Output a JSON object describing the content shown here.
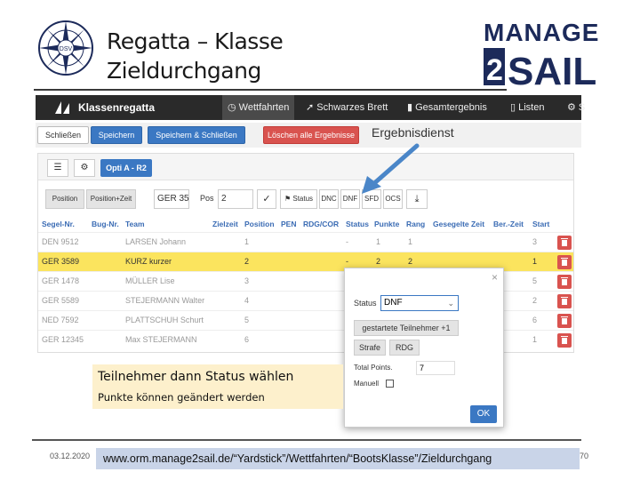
{
  "slide": {
    "title_line1": "Regatta – Klasse",
    "title_line2": "Zieldurchgang",
    "logo_right_line1": "MANAGE",
    "logo_right_num": "2",
    "logo_right_line2": "SAIL",
    "logo_left_text": "DSV"
  },
  "navbar": {
    "brand": "Klassenregatta",
    "items": [
      "Wettfahrten",
      "Schwarzes Brett",
      "Gesamtergebnis",
      "Listen",
      "S"
    ],
    "active_index": 0
  },
  "toolbar": {
    "buttons": [
      "Schließen",
      "Speichern",
      "Speichern & Schließen",
      "Löschen alle Ergebnisse"
    ],
    "heading": "Ergebnisdienst"
  },
  "race": {
    "label": "Opti A - R2"
  },
  "controls": {
    "position_tab": "Position",
    "position_time_tab": "Position+Zeit",
    "sail_no_value": "GER 35",
    "pos_label": "Pos",
    "pos_value": "2",
    "status_btn": "Status",
    "quick": [
      "DNC",
      "DNF",
      "SFD",
      "OCS"
    ]
  },
  "table": {
    "headers": [
      "Segel-Nr.",
      "Bug-Nr.",
      "Team",
      "Zielzeit",
      "Position",
      "PEN",
      "RDG/COR",
      "Status",
      "Punkte",
      "Rang",
      "Gesegelte Zeit",
      "Ber.-Zeit",
      "Start"
    ],
    "rows": [
      {
        "sail": "DEN 9512",
        "team": "LARSEN Johann",
        "position": "1",
        "status": "-",
        "points": "1",
        "rank": "1",
        "start": "3",
        "selected": false
      },
      {
        "sail": "GER 3589",
        "team": "KURZ kurzer",
        "position": "2",
        "status": "-",
        "points": "2",
        "rank": "2",
        "start": "1",
        "selected": true
      },
      {
        "sail": "GER 1478",
        "team": "MÜLLER Lise",
        "position": "3",
        "status": "",
        "points": "",
        "rank": "",
        "start": "5",
        "selected": false
      },
      {
        "sail": "GER 5589",
        "team": "STEJERMANN Walter",
        "position": "4",
        "status": "",
        "points": "",
        "rank": "",
        "start": "2",
        "selected": false
      },
      {
        "sail": "NED 7592",
        "team": "PLATTSCHUH Schurt",
        "position": "5",
        "status": "",
        "points": "",
        "rank": "",
        "start": "6",
        "selected": false
      },
      {
        "sail": "GER 12345",
        "team": "Max STEJERMANN",
        "position": "6",
        "status": "",
        "points": "",
        "rank": "",
        "start": "1",
        "selected": false
      }
    ]
  },
  "modal": {
    "close": "×",
    "status_label": "Status",
    "status_value": "DNF",
    "started_btn": "gestartete Teilnehmer +1",
    "penalty_btn": "Strafe",
    "rdg_btn": "RDG",
    "total_points_label": "Total Points.",
    "total_points_value": "7",
    "manual_label": "Manuell",
    "ok": "OK"
  },
  "callout": {
    "line1": "Teilnehmer dann Status wählen",
    "line2": "Punkte können geändert werden"
  },
  "footer": {
    "date": "03.12.2020",
    "url": "www.orm.manage2sail.de/“Yardstick”/Wettfahrten/“BootsKlasse”/Zieldurchgang",
    "page": "70"
  },
  "colors": {
    "accent_blue": "#3b78c3",
    "danger_red": "#d9534f",
    "selected_row": "#fbe45e",
    "navbar": "#2a2a2a",
    "logo_navy": "#1c2a5a",
    "arrow_blue": "#4a86c8"
  }
}
